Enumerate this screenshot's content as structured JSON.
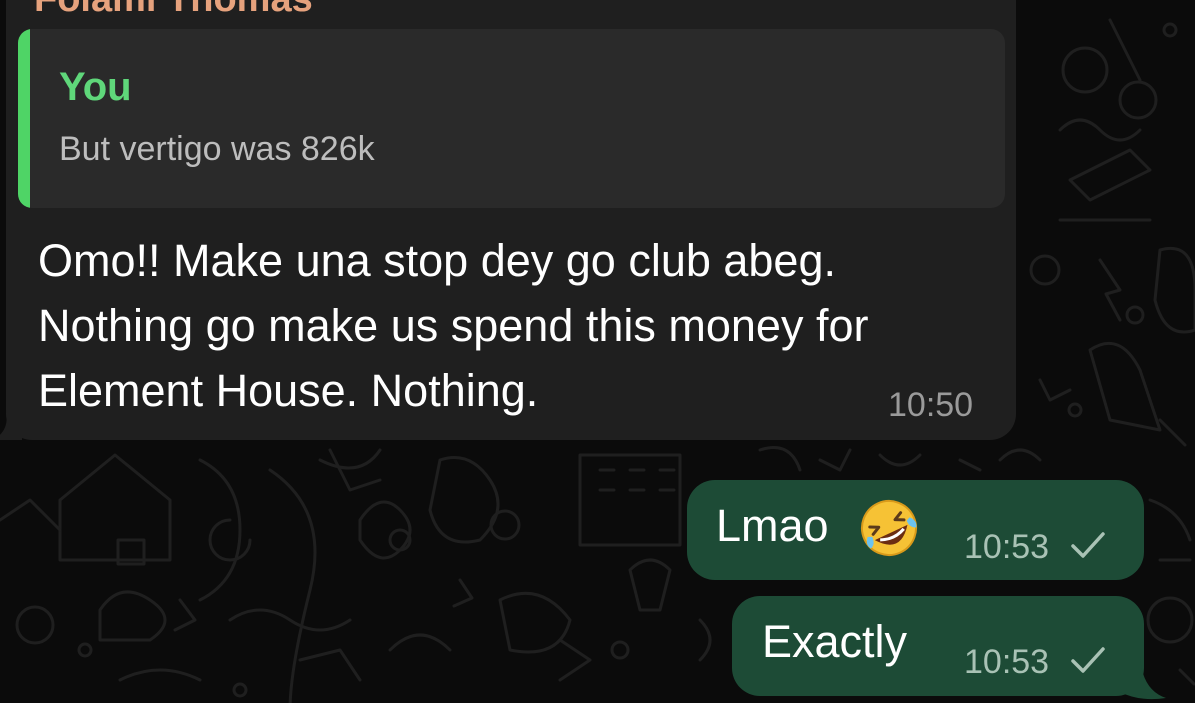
{
  "chat": {
    "incoming": {
      "sender_name": "Folami Thomas",
      "quote": {
        "author": "You",
        "text": "But vertigo was 826k"
      },
      "lines": [
        "Omo!! Make una stop dey go club abeg.",
        "Nothing go make us spend this money for",
        "Element House. Nothing."
      ],
      "time": "10:50"
    },
    "outgoing": [
      {
        "text": "Lmao",
        "emoji": "rolling-on-floor-laughing-emoji",
        "time": "10:53",
        "status": "sent-check-icon"
      },
      {
        "text": "Exactly",
        "time": "10:53",
        "status": "sent-check-icon"
      }
    ]
  },
  "colors": {
    "background": "#0b0b0b",
    "incoming_bubble": "#1f1f1f",
    "quote_background": "#2a2a2a",
    "quote_accent": "#4fd466",
    "sender_name": "#e6a27d",
    "outgoing_bubble": "#1d4b36"
  }
}
